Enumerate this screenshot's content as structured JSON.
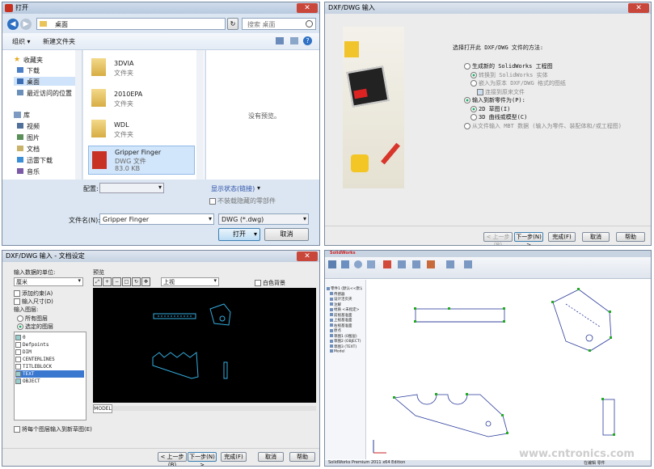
{
  "open_dialog": {
    "title": "打开",
    "address": "桌面",
    "search_placeholder": "搜索 桌面",
    "toolbar": {
      "organize": "组织 ▾",
      "new_folder": "新建文件夹"
    },
    "nav": {
      "favorites": "收藏夹",
      "fav_items": [
        "下载",
        "桌面",
        "最近访问的位置"
      ],
      "libraries": "库",
      "lib_items": [
        "视频",
        "图片",
        "文档",
        "迅雷下载",
        "音乐"
      ]
    },
    "files": [
      {
        "name": "3DVIA",
        "type": "文件夹"
      },
      {
        "name": "2010EPA",
        "type": "文件夹"
      },
      {
        "name": "WDL",
        "type": "文件夹"
      },
      {
        "name": "Gripper Finger",
        "type": "DWG 文件",
        "size": "83.0 KB"
      }
    ],
    "preview_text": "没有预览。",
    "config_label": "配置:",
    "display_status": "显示状态(链接)",
    "hide_parts": "不装载隐藏的零部件",
    "filename_label": "文件名(N):",
    "filename_value": "Gripper Finger",
    "filter_value": "DWG (*.dwg)",
    "open_btn": "打开",
    "cancel_btn": "取消"
  },
  "import_dialog": {
    "title": "DXF/DWG 输入",
    "prompt": "选择打开此 DXF/DWG 文件的方法:",
    "options": [
      {
        "label": "生成新的 SolidWorks 工程图",
        "indent": 0,
        "kind": "radio",
        "on": false,
        "dim": false
      },
      {
        "label": "转换到 SolidWorks 实体",
        "indent": 1,
        "kind": "radio",
        "on": true,
        "dim": true
      },
      {
        "label": "嵌入为原本 DXF/DWG 格式的图纸",
        "indent": 1,
        "kind": "radio",
        "on": false,
        "dim": true
      },
      {
        "label": "连接到原来文件",
        "indent": 2,
        "kind": "check",
        "on": true,
        "dim": true
      },
      {
        "label": "输入到新零件为(P):",
        "indent": 0,
        "kind": "radio",
        "on": true,
        "dim": false
      },
      {
        "label": "2D 草图(I)",
        "indent": 1,
        "kind": "radio",
        "on": true,
        "dim": false
      },
      {
        "label": "3D 曲线或模型(C)",
        "indent": 1,
        "kind": "radio",
        "on": false,
        "dim": false
      },
      {
        "label": "从文件输入 MBT 数据 (输入为零件、装配体和/或工程图)",
        "indent": 0,
        "kind": "radio",
        "on": false,
        "dim": true
      }
    ],
    "buttons": [
      "< 上一步(B)",
      "下一步(N) >",
      "完成(F)",
      "取消",
      "帮助"
    ]
  },
  "doc_settings": {
    "title": "DXF/DWG 输入 - 文档设定",
    "unit_label": "输入数据的单位:",
    "unit_value": "厘米",
    "add_constraints": "添加约束(A)",
    "import_dims": "输入尺寸(D)",
    "layers_label": "输入图层:",
    "all_layers": "所有图层",
    "selected_layers": "选定的图层",
    "layers": [
      "0",
      "Defpoints",
      "DIM",
      "CENTERLINES",
      "TITLEBLOCK",
      "TEXT",
      "OBJECT"
    ],
    "merge_layers": "将每个图层输入到新草图(E)",
    "preview_label": "预览",
    "view_value": "上视",
    "white_bg": "白色背景",
    "model_tab": "MODEL",
    "buttons": [
      "< 上一步(B)",
      "下一步(N) >",
      "完成(F)",
      "取消",
      "帮助"
    ]
  },
  "solidworks": {
    "app_title": "SolidWorks",
    "tree_items": [
      "零件1 (默认<<默认>_显示状态 1>)",
      "传感器",
      "设计活页夹",
      "注解",
      "材质 <未指定>",
      "前视基准面",
      "上视基准面",
      "右视基准面",
      "原点",
      "草图1 (0图层)",
      "草图2 (OBJECT)",
      "草图3 (TEXT)",
      "Model"
    ],
    "status_left": "SolidWorks Premium 2011 x64 Edition",
    "status_right": "在编辑 零件",
    "watermark": "www.cntronics.com"
  },
  "colors": {
    "accent": "#3a6ea5",
    "cad_line": "#34aee0",
    "sketch_blue": "#2a3a9a",
    "point_green": "#22aa22"
  }
}
